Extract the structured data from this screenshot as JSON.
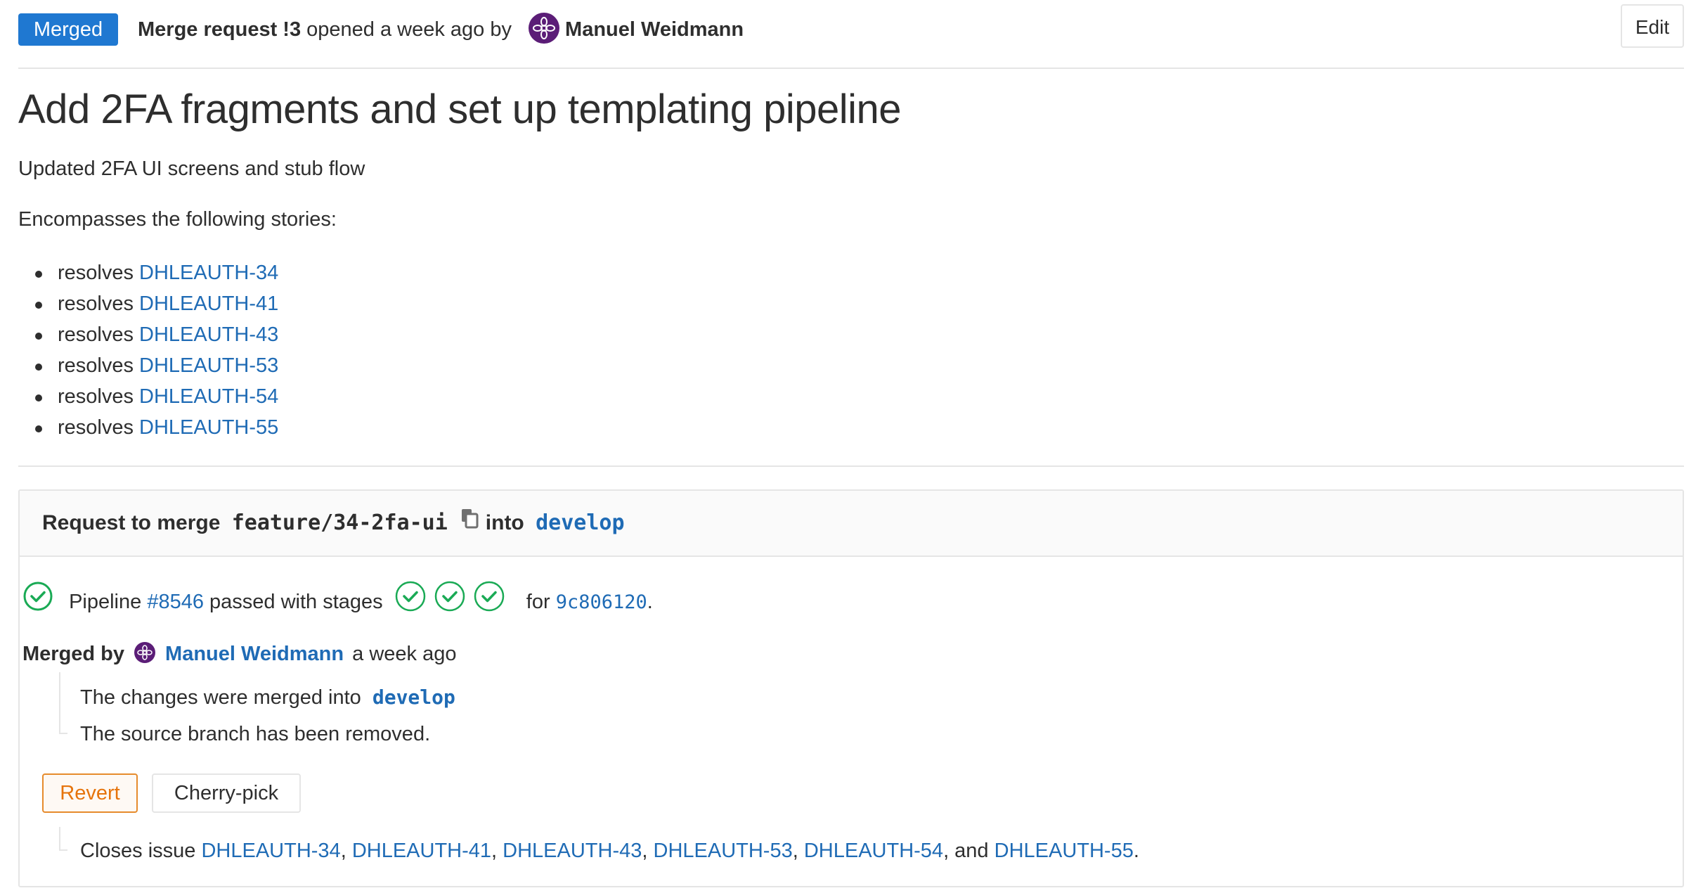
{
  "header": {
    "status_badge": "Merged",
    "mr_label": "Merge request !3",
    "opened_text": " opened a week ago by ",
    "author": "Manuel Weidmann",
    "edit_label": "Edit"
  },
  "title": "Add 2FA fragments and set up templating pipeline",
  "description": {
    "line1": "Updated 2FA UI screens and stub flow",
    "line2": "Encompasses the following stories:",
    "stories": [
      {
        "prefix": "resolves ",
        "issue": "DHLEAUTH-34"
      },
      {
        "prefix": "resolves ",
        "issue": "DHLEAUTH-41"
      },
      {
        "prefix": "resolves ",
        "issue": "DHLEAUTH-43"
      },
      {
        "prefix": "resolves ",
        "issue": "DHLEAUTH-53"
      },
      {
        "prefix": "resolves ",
        "issue": "DHLEAUTH-54"
      },
      {
        "prefix": "resolves ",
        "issue": "DHLEAUTH-55"
      }
    ]
  },
  "widget": {
    "request_prefix": "Request to merge",
    "source_branch": "feature/34-2fa-ui",
    "into_label": "into",
    "target_branch": "develop",
    "pipeline": {
      "prefix": "Pipeline ",
      "id": "#8546",
      "status_text": " passed with stages",
      "for_label": "for",
      "commit": "9c806120",
      "period": ".",
      "stage_count": 3
    },
    "merged_by": {
      "label": "Merged by",
      "user": "Manuel Weidmann",
      "time": "a week ago",
      "changes_text": "The changes were merged into",
      "target_branch": "develop",
      "source_removed": "The source branch has been removed."
    },
    "buttons": {
      "revert": "Revert",
      "cherry_pick": "Cherry-pick"
    },
    "closes": {
      "prefix": "Closes issue ",
      "issues": [
        "DHLEAUTH-34",
        "DHLEAUTH-41",
        "DHLEAUTH-43",
        "DHLEAUTH-53",
        "DHLEAUTH-54",
        "DHLEAUTH-55"
      ],
      "sep1": ", ",
      "sep2": ", ",
      "sep3": ", ",
      "sep4": ", ",
      "and_text": ", and ",
      "end": "."
    }
  },
  "colors": {
    "link": "#1f6bb5",
    "badge": "#1f78d1",
    "success": "#1aaa55",
    "warning": "#e6740c",
    "avatar": "#5b1d77"
  },
  "icons": {
    "avatar": "flower-avatar-icon",
    "copy": "clipboard-icon",
    "pipeline_status": "check-circle-icon",
    "stage": "check-circle-icon"
  }
}
